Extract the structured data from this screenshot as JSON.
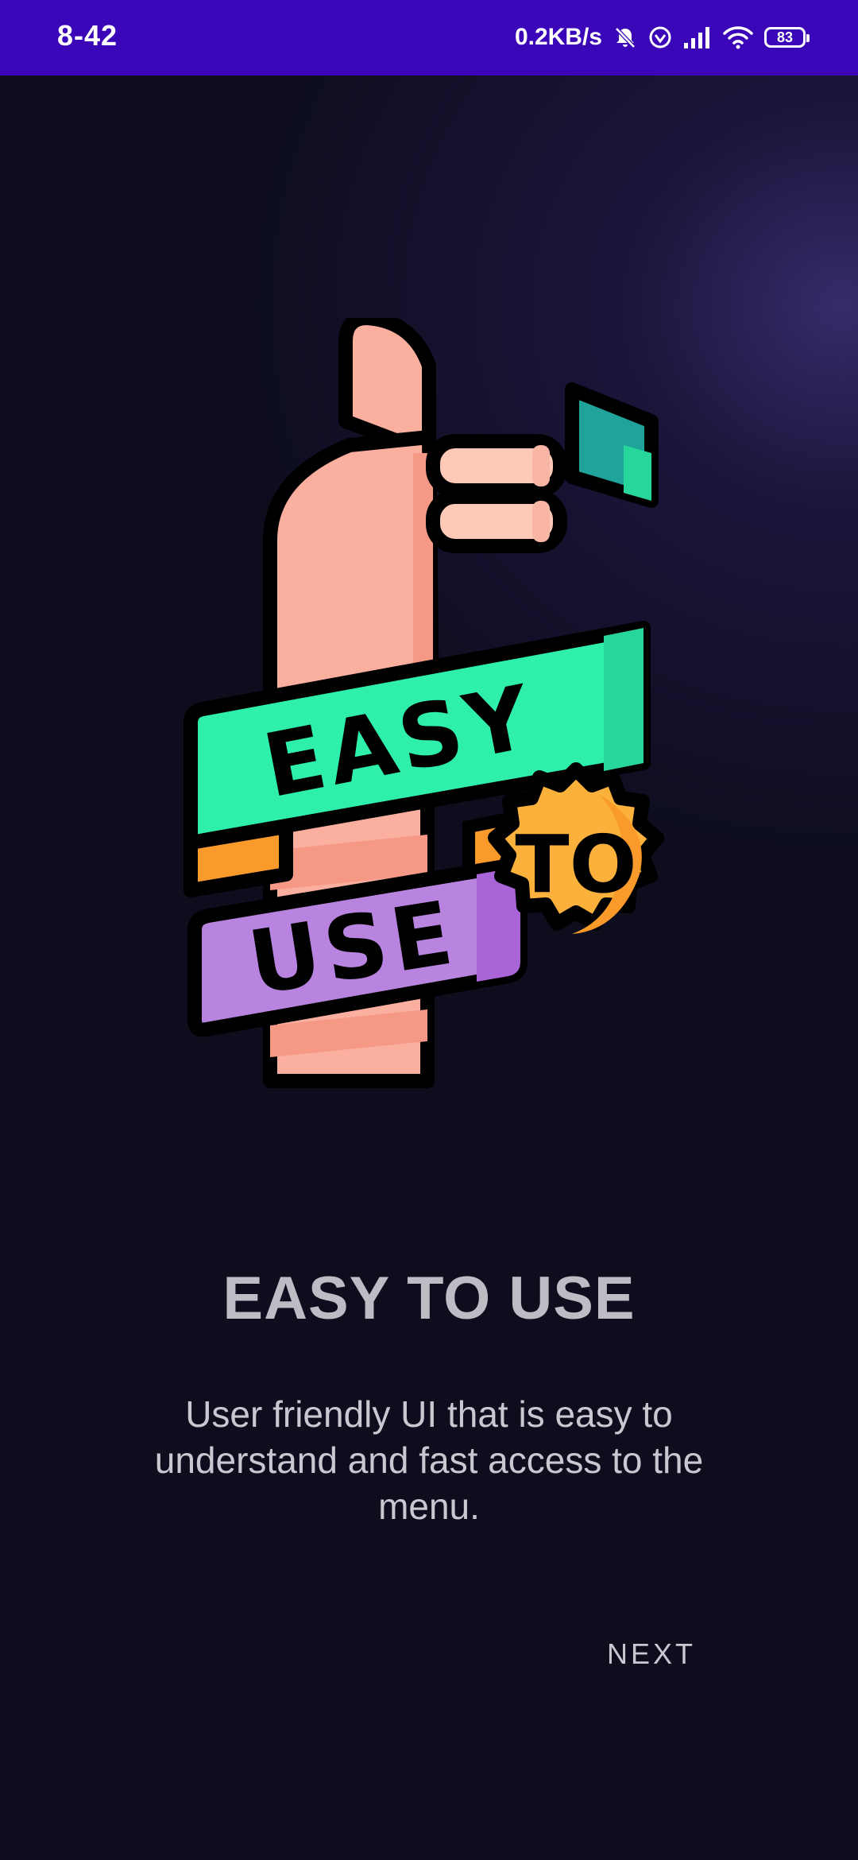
{
  "status_bar": {
    "time": "8-42",
    "network_speed": "0.2KB/s",
    "battery_level": "83",
    "icons": [
      "mute-icon",
      "vpn-icon",
      "signal-icon",
      "wifi-icon",
      "battery-icon"
    ]
  },
  "onboarding": {
    "illustration": {
      "ribbon_top_text": "EASY",
      "badge_text": "TO",
      "ribbon_bottom_text": "USE"
    },
    "title": "EASY TO USE",
    "description": "User friendly UI that is easy to understand and fast access to the menu.",
    "next_label": "NEXT"
  },
  "colors": {
    "status_bar": "#3a06b8",
    "background": "#0d0d1e",
    "skin": "#fbb09f",
    "green_ribbon": "#2ef0aa",
    "purple_ribbon": "#b884e0",
    "orange_badge": "#f9a83c"
  }
}
